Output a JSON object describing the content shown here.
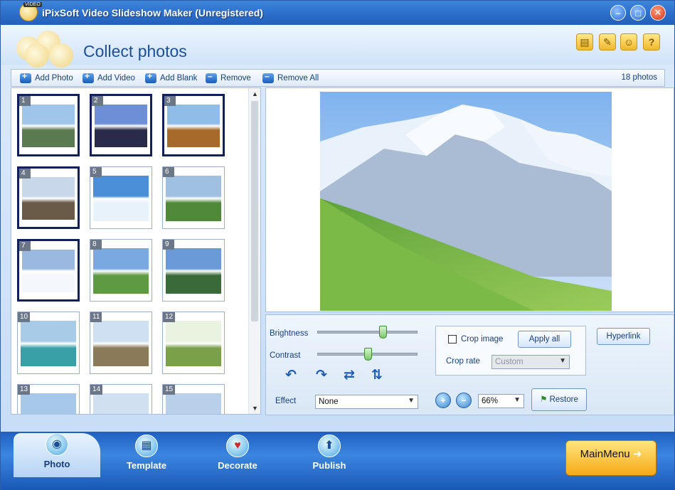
{
  "window": {
    "title": "iPixSoft Video Slideshow Maker (Unregistered)",
    "icon_badge": "VIDEO",
    "min_label": "–",
    "max_label": "□",
    "close_label": "✕"
  },
  "header": {
    "page_title": "Collect photos",
    "icons": [
      "folder-icon",
      "note-icon",
      "person-icon",
      "help-icon"
    ],
    "icon_glyphs": [
      "▤",
      "✎",
      "☺",
      "?"
    ]
  },
  "toolbar": {
    "add_photo": "Add Photo",
    "add_video": "Add Video",
    "add_blank": "Add Blank",
    "remove": "Remove",
    "remove_all": "Remove All",
    "count": "18 photos"
  },
  "thumbnails": [
    {
      "num": "1",
      "selected": true
    },
    {
      "num": "2",
      "selected": true
    },
    {
      "num": "3",
      "selected": true
    },
    {
      "num": "4",
      "selected": true
    },
    {
      "num": "5",
      "selected": false
    },
    {
      "num": "6",
      "selected": false
    },
    {
      "num": "7",
      "selected": true
    },
    {
      "num": "8",
      "selected": false
    },
    {
      "num": "9",
      "selected": false
    },
    {
      "num": "10",
      "selected": false
    },
    {
      "num": "11",
      "selected": false
    },
    {
      "num": "12",
      "selected": false
    },
    {
      "num": "13",
      "selected": false
    },
    {
      "num": "14",
      "selected": false
    },
    {
      "num": "15",
      "selected": false
    }
  ],
  "controls": {
    "brightness_label": "Brightness",
    "contrast_label": "Contrast",
    "effect_label": "Effect",
    "effect_value": "None",
    "crop_image_label": "Crop image",
    "crop_checked": false,
    "apply_all": "Apply all",
    "crop_rate_label": "Crop rate",
    "crop_rate_value": "Custom",
    "hyperlink": "Hyperlink",
    "zoom_value": "66%",
    "restore": "Restore",
    "brightness_level": 0.65,
    "contrast_level": 0.5
  },
  "bottom_tabs": [
    {
      "label": "Photo",
      "active": true
    },
    {
      "label": "Template",
      "active": false
    },
    {
      "label": "Decorate",
      "active": false
    },
    {
      "label": "Publish",
      "active": false
    }
  ],
  "main_menu": "MainMenu"
}
